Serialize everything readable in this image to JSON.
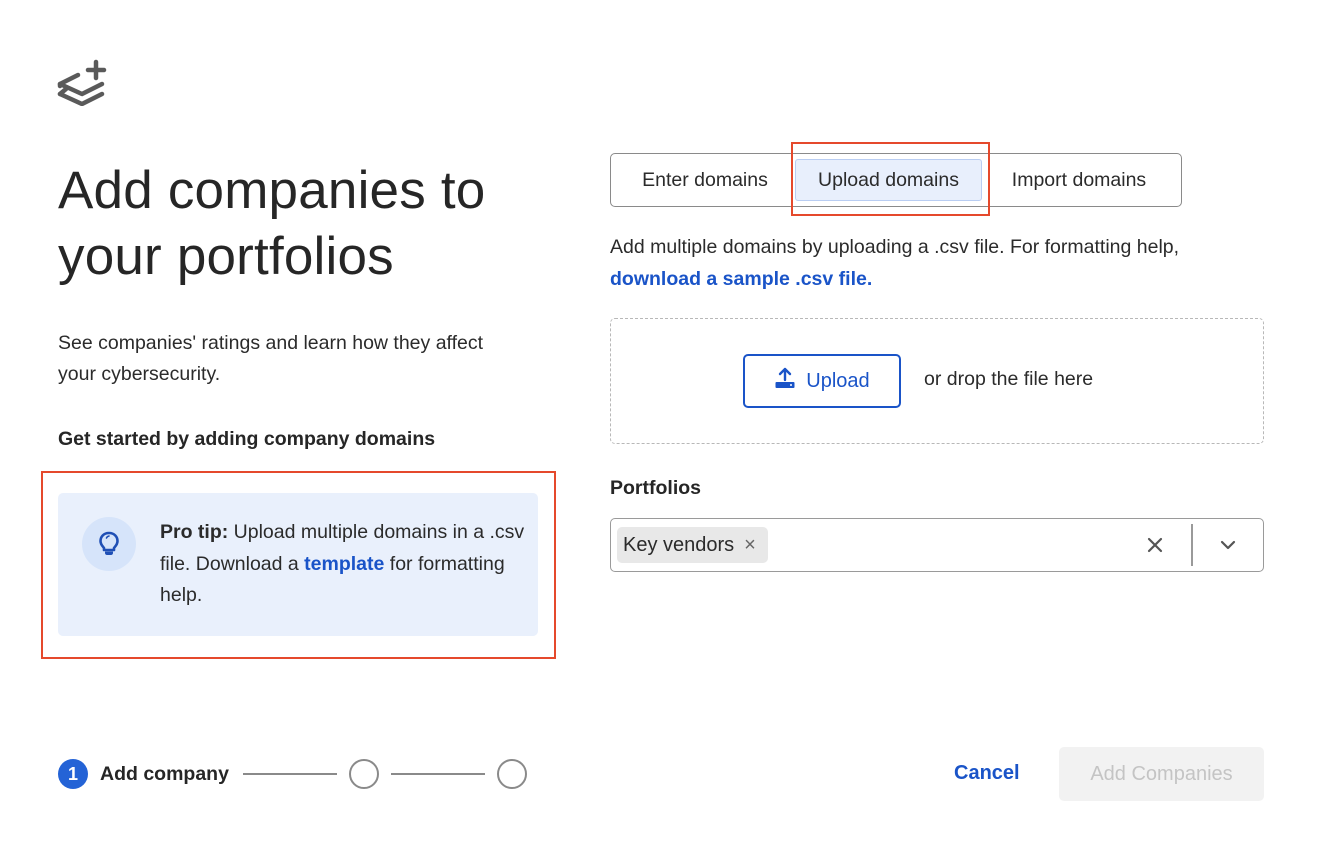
{
  "header": {
    "logo_icon": "layers-plus-icon",
    "title": "Add companies to your portfolios",
    "subtitle": "See companies' ratings and learn how they affect your cybersecurity.",
    "get_started": "Get started by adding company domains"
  },
  "pro_tip": {
    "icon": "lightbulb-icon",
    "label": "Pro tip:",
    "text_before_link": " Upload multiple domains in a .csv file. Download a ",
    "link_text": "template",
    "text_after_link": " for formatting help."
  },
  "tabs": [
    {
      "label": "Enter domains",
      "selected": false
    },
    {
      "label": "Upload domains",
      "selected": true
    },
    {
      "label": "Import domains",
      "selected": false
    }
  ],
  "upload_section": {
    "description": "Add multiple domains by uploading a .csv file. For formatting help,",
    "sample_link": "download a sample .csv file.",
    "upload_button": "Upload",
    "upload_icon": "upload-icon",
    "drop_text": "or drop the file here"
  },
  "portfolios": {
    "label": "Portfolios",
    "selected": [
      {
        "label": "Key vendors"
      }
    ],
    "clear_icon": "close-icon",
    "dropdown_icon": "chevron-down-icon"
  },
  "stepper": {
    "current_step": "1",
    "current_label": "Add company",
    "total_steps": 3
  },
  "footer": {
    "cancel_label": "Cancel",
    "submit_label": "Add Companies",
    "submit_disabled": true
  },
  "colors": {
    "accent": "#1a54c8",
    "step_active": "#2463d6",
    "tip_background": "#e9f0fc",
    "highlight": "#e5492c"
  }
}
